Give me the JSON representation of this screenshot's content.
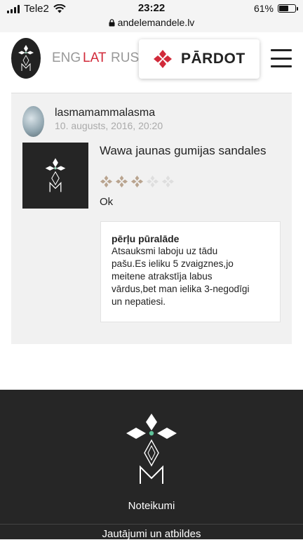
{
  "status_bar": {
    "carrier": "Tele2",
    "time": "23:22",
    "url": "andelemandele.lv",
    "battery": "61%",
    "battery_level": 0.61
  },
  "header": {
    "logo_icon": "andelemandele-logo-icon",
    "languages": [
      {
        "code": "ENG",
        "active": false
      },
      {
        "code": "LAT",
        "active": true
      },
      {
        "code": "RUS",
        "active": false
      }
    ],
    "sell_label": "PĀRDOT",
    "sell_icon": "red-diamond-icon",
    "menu_icon": "hamburger-icon",
    "accent_color": "#d12a3a"
  },
  "review": {
    "username": "lasmamammalasma",
    "date": "10. augusts, 2016, 20:20",
    "product_title": "Wawa jaunas gumijas sandales",
    "rating": 3,
    "rating_max": 5,
    "text": "Ok",
    "reply": {
      "author": "pērļu pūralāde",
      "lines": [
        "Atsauksmi laboju uz tādu",
        "pašu.Es ieliku 5 zvaigznes,jo",
        "meitene atrakstīja labus",
        "vārdus,bet man ielika 3-negodīgi",
        "un nepatiesi."
      ]
    }
  },
  "footer": {
    "logo_icon": "andelemandele-footer-logo-icon",
    "links": [
      "Noteikumi",
      "Jautājumi un atbildes"
    ]
  }
}
